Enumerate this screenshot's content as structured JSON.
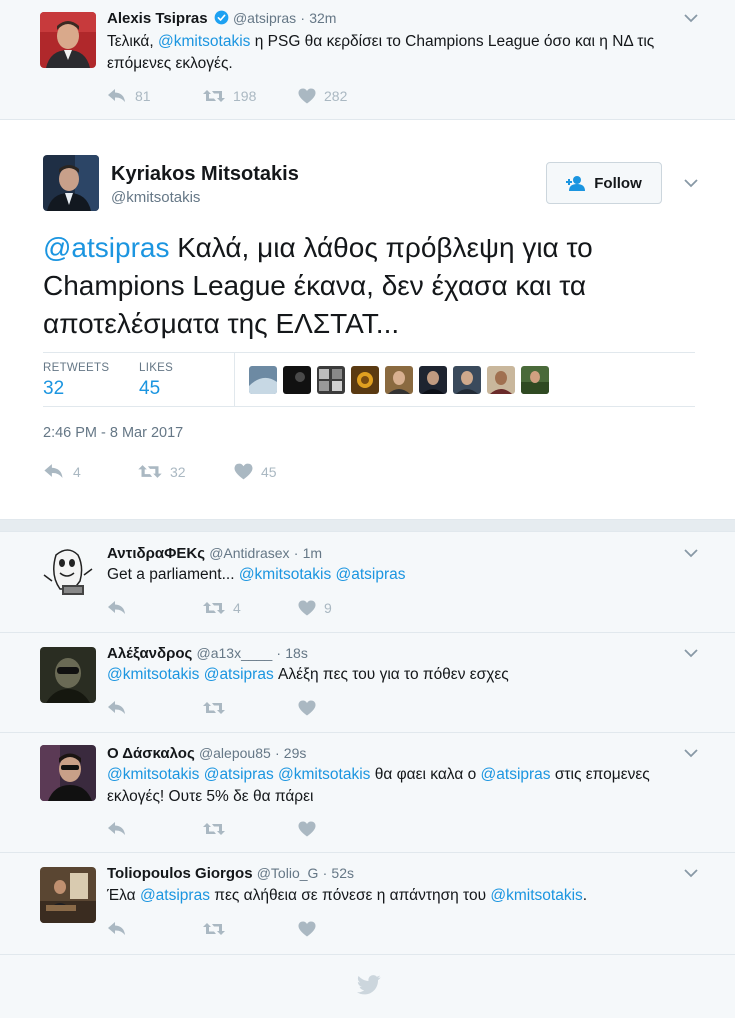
{
  "tweet1": {
    "name": "Alexis Tsipras",
    "handle": "@atsipras",
    "time": "32m",
    "text_before": "Τελικά, ",
    "mention": "@kmitsotakis",
    "text_after": " η PSG θα κερδίσει το Champions League όσο και η ΝΔ τις επόμενες εκλογές.",
    "replies": "81",
    "retweets": "198",
    "likes": "282"
  },
  "main": {
    "name": "Kyriakos Mitsotakis",
    "handle": "@kmitsotakis",
    "follow_label": "Follow",
    "mention": "@atsipras",
    "text": " Καλά, μια λάθος πρόβλεψη για το Champions League έκανα, δεν έχασα και τα αποτελέσματα της ΕΛΣΤΑΤ...",
    "retweets_label": "RETWEETS",
    "retweets_value": "32",
    "likes_label": "LIKES",
    "likes_value": "45",
    "date": "2:46 PM - 8 Mar 2017",
    "replies": "4",
    "retweets": "32",
    "likes": "45"
  },
  "replies": [
    {
      "name": "ΑντιδραΦΕΚς",
      "handle": "@Antidrasex",
      "time": "1m",
      "text_before": "Get a parliament... ",
      "m1": "@kmitsotakis",
      "m2": "@atsipras",
      "retweets": "4",
      "likes": "9"
    },
    {
      "name": "Αλέξανδρος",
      "handle": "@a13x____",
      "time": "18s",
      "m1": "@kmitsotakis",
      "m2": "@atsipras",
      "text_after": " Αλέξη πες του για το πόθεν εσχες"
    },
    {
      "name": "Ο Δάσκαλος",
      "handle": "@alepou85",
      "time": "29s",
      "m1": "@kmitsotakis",
      "m2": "@atsipras",
      "m3": "@kmitsotakis",
      "text_mid": " θα φαει καλα ο ",
      "m4": "@atsipras",
      "text_after": " στις επομενες εκλογές! Ουτε 5% δε θα πάρει"
    },
    {
      "name": "Toliopoulos Giorgos",
      "handle": "@Tolio_G",
      "time": "52s",
      "text_before": "Έλα ",
      "m1": "@atsipras",
      "text_mid": " πες αλήθεια σε πόνεσε η απάντηση του ",
      "m2": "@kmitsotakis",
      "text_after": "."
    }
  ],
  "colors": {
    "link": "#1b95e0",
    "verified": "#1da1f2",
    "muted": "#657786",
    "icon": "#aab8c2"
  }
}
